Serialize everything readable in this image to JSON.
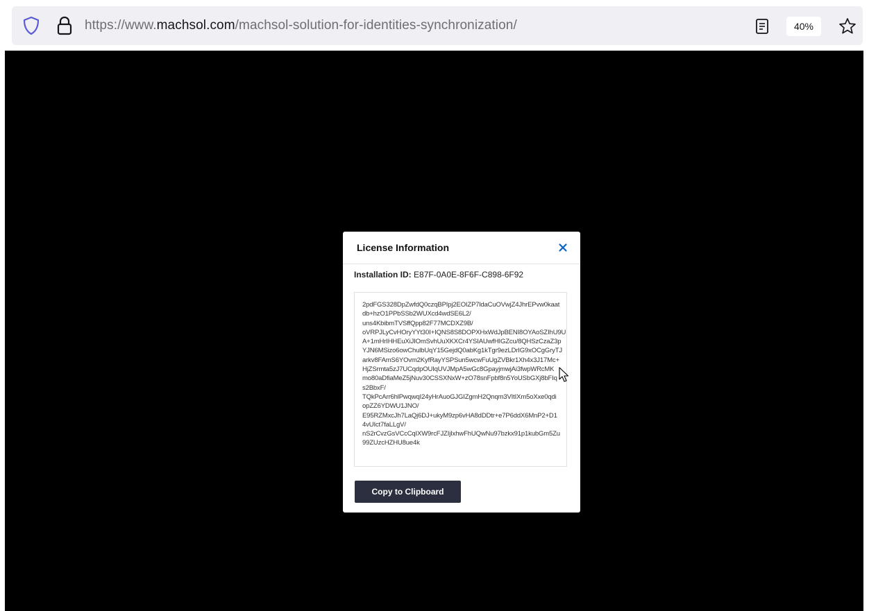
{
  "browser": {
    "url_prefix": "https://www.",
    "url_domain": "machsol.com",
    "url_path": "/machsol-solution-for-identities-synchronization/",
    "zoom": "40%"
  },
  "dialog": {
    "title": "License Information",
    "installation_label": "Installation ID:",
    "installation_id": "E87F-0A0E-8F6F-C898-6F92",
    "license_lines": [
      "2pdFGS328DpZwfdQ0czqBPIpj2EOIZP7ldaCuOVwjZ4JhrEPvw0kaat",
      "db+hzO1PPbSSb2WUXcd4wdSE6L2/",
      "uns4KbibmTVSffQpp82F77MCDXZ9B/",
      "oVRPJLyCvHOryYYt30I+IQNS8S8DOPXHxWdJpBENI8OYAoSZIhU9U",
      "A+1mHrIHHEuXiJIOmSvhUuXKXCr4YSIAUwfHIGZcu/8QHSzCzaZ3p",
      "YJN6MSizo6owChulbUqY15GejdQ0abKg1kTgr9ezLDrIG9xOCgGryTJ",
      "arkv8FAmS6YOvm2KyfRayYSPSun5wcwFuUgZVBkr1Xh4x3J17Mc+",
      "HjZSrmta5zJ7UCqdpOUIqUVJMpA5wGc8GpayjmwjAi3fwpWRcMK",
      "mo80aDfiaMeZ5jNuv30CSSXNxW+zO78snFpbf8n5YoUSbGXj8bFIq",
      "s2BbxF/",
      "TQkPcArr6hlPwqwqI24yHrAuoGJGIZgmH2Qnqm3VItIXm5oXxe0qdi",
      "opZZ6YDWU1JNO/",
      "E95RZMxcJh7LaQj6DJ+ukyM9zp6vHA8dDDtr+e7P6ddX6MnP2+D1",
      "4vUIct7faLLgV/",
      "nS2rCvzGsVCcCqIXW9rcFJZIjIxhwFhUQwNu97bzkx91p1kubGm5Zu",
      "99ZUzcHZHU8ue4k"
    ],
    "copy_button": "Copy to Clipboard"
  },
  "colors": {
    "page_background": "#000000",
    "button_background": "#2c2f3f",
    "close_icon": "#0b63c4",
    "shield_icon": "#5b5bd6"
  },
  "icons": {
    "tracking": "shield-icon",
    "security": "lock-icon",
    "reader": "reader-view-icon",
    "bookmark": "star-icon",
    "close": "close-icon",
    "pointer": "mouse-cursor-icon"
  }
}
